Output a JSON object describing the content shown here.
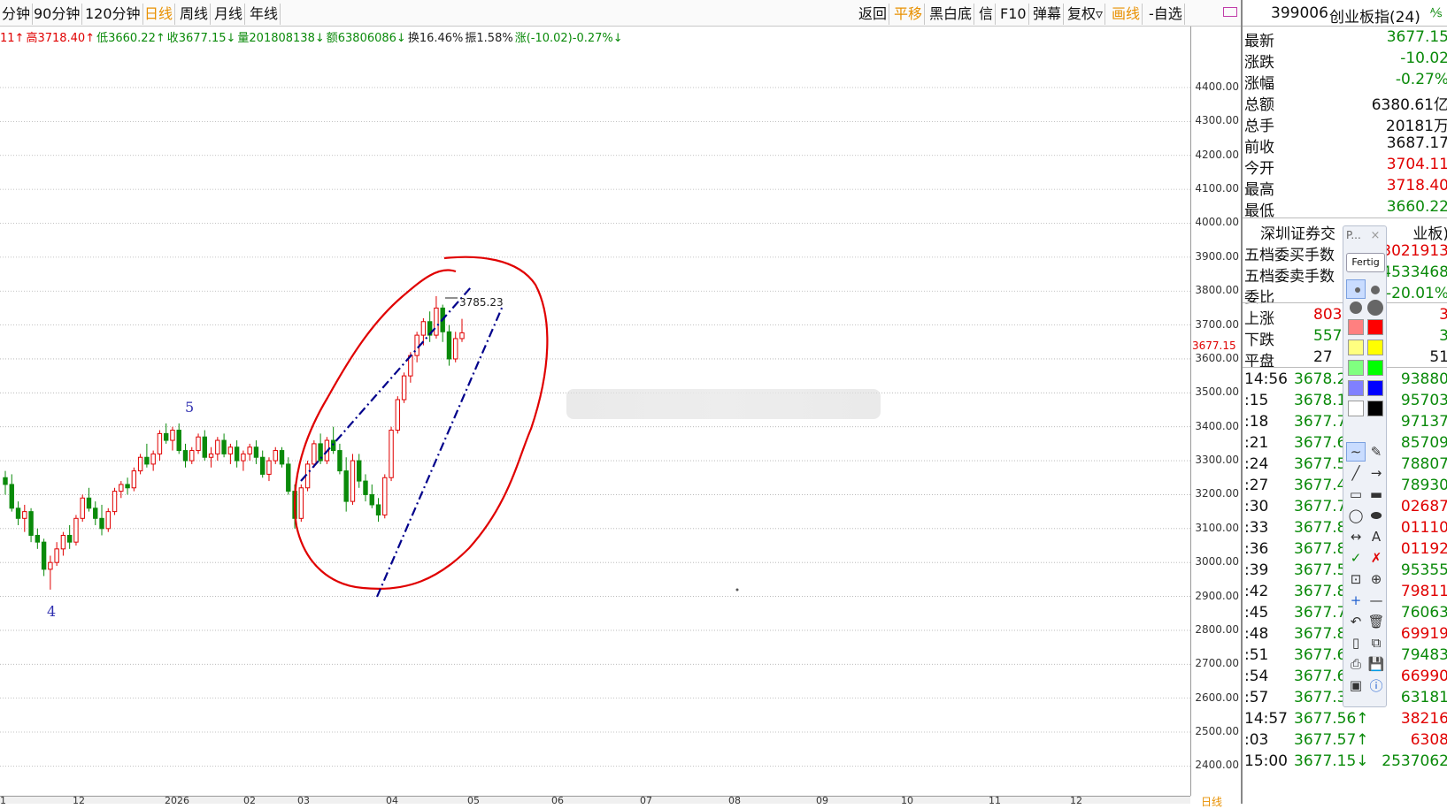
{
  "toolbar": {
    "left_tabs": [
      {
        "label": "分钟",
        "active": false
      },
      {
        "label": "90分钟",
        "active": false
      },
      {
        "label": "120分钟",
        "active": false
      },
      {
        "label": "日线",
        "active": true
      },
      {
        "label": "周线",
        "active": false
      },
      {
        "label": "月线",
        "active": false
      },
      {
        "label": "年线",
        "active": false
      }
    ],
    "right_buttons": [
      {
        "label": "返回",
        "highlight": false
      },
      {
        "label": "平移",
        "highlight": true
      },
      {
        "label": "黑白底",
        "highlight": false
      },
      {
        "label": "信",
        "highlight": false
      },
      {
        "label": "F10",
        "highlight": false
      },
      {
        "label": "弹幕",
        "highlight": false
      },
      {
        "label": "复权▿",
        "highlight": false
      },
      {
        "label": "画线",
        "highlight": true
      },
      {
        "label": "-自选",
        "highlight": false
      }
    ]
  },
  "infoline": [
    {
      "text": "11↑",
      "color": "red"
    },
    {
      "text": "高3718.40↑",
      "color": "red"
    },
    {
      "text": "低3660.22↑",
      "color": "green"
    },
    {
      "text": "收3677.15↓",
      "color": "green"
    },
    {
      "text": "量201808138↓",
      "color": "green"
    },
    {
      "text": "额63806086↓",
      "color": "green"
    },
    {
      "text": "换16.46%",
      "color": "black"
    },
    {
      "text": "振1.58%",
      "color": "black"
    },
    {
      "text": "涨(-10.02)-0.27%↓",
      "color": "green"
    }
  ],
  "price_axis": {
    "ticks": [
      "4400.00",
      "4300.00",
      "4200.00",
      "4100.00",
      "4000.00",
      "3900.00",
      "3800.00",
      "3700.00",
      "3600.00",
      "3500.00",
      "3400.00",
      "3300.00",
      "3200.00",
      "3100.00",
      "3000.00",
      "2900.00",
      "2800.00",
      "2700.00",
      "2600.00",
      "2500.00",
      "2400.00"
    ],
    "last_price": "3677.15"
  },
  "date_axis": {
    "ticks": [
      "1",
      "12",
      "2026",
      "02",
      "03",
      "04",
      "05",
      "06",
      "07",
      "08",
      "09",
      "10",
      "11",
      "12"
    ],
    "bottom_label": "日线"
  },
  "chart_data": {
    "type": "candlestick",
    "wave_labels": [
      "4",
      "5"
    ],
    "high_marker_label": "3785.23",
    "ylim": [
      2400,
      4450
    ],
    "candles": [
      [
        3250,
        3270,
        3200,
        3230
      ],
      [
        3230,
        3260,
        3150,
        3160
      ],
      [
        3160,
        3180,
        3110,
        3130
      ],
      [
        3130,
        3170,
        3090,
        3150
      ],
      [
        3150,
        3160,
        3060,
        3080
      ],
      [
        3080,
        3100,
        3040,
        3060
      ],
      [
        3060,
        3070,
        2960,
        2980
      ],
      [
        2980,
        3020,
        2920,
        3000
      ],
      [
        3000,
        3060,
        2990,
        3040
      ],
      [
        3040,
        3090,
        3020,
        3080
      ],
      [
        3080,
        3110,
        3040,
        3060
      ],
      [
        3060,
        3140,
        3050,
        3130
      ],
      [
        3130,
        3200,
        3120,
        3190
      ],
      [
        3190,
        3220,
        3150,
        3160
      ],
      [
        3160,
        3180,
        3110,
        3130
      ],
      [
        3130,
        3170,
        3080,
        3100
      ],
      [
        3100,
        3160,
        3090,
        3150
      ],
      [
        3150,
        3220,
        3140,
        3210
      ],
      [
        3210,
        3240,
        3190,
        3230
      ],
      [
        3230,
        3250,
        3200,
        3220
      ],
      [
        3220,
        3280,
        3210,
        3270
      ],
      [
        3270,
        3320,
        3260,
        3310
      ],
      [
        3310,
        3350,
        3280,
        3290
      ],
      [
        3290,
        3330,
        3270,
        3320
      ],
      [
        3320,
        3390,
        3300,
        3380
      ],
      [
        3380,
        3410,
        3350,
        3360
      ],
      [
        3360,
        3400,
        3330,
        3390
      ],
      [
        3390,
        3410,
        3320,
        3330
      ],
      [
        3330,
        3350,
        3280,
        3300
      ],
      [
        3300,
        3340,
        3290,
        3330
      ],
      [
        3330,
        3380,
        3320,
        3370
      ],
      [
        3370,
        3390,
        3300,
        3310
      ],
      [
        3310,
        3340,
        3280,
        3320
      ],
      [
        3320,
        3370,
        3300,
        3360
      ],
      [
        3360,
        3380,
        3310,
        3320
      ],
      [
        3320,
        3350,
        3290,
        3340
      ],
      [
        3340,
        3360,
        3280,
        3300
      ],
      [
        3300,
        3330,
        3270,
        3320
      ],
      [
        3320,
        3350,
        3300,
        3340
      ],
      [
        3340,
        3360,
        3290,
        3310
      ],
      [
        3310,
        3330,
        3250,
        3260
      ],
      [
        3260,
        3310,
        3240,
        3300
      ],
      [
        3300,
        3340,
        3290,
        3330
      ],
      [
        3330,
        3340,
        3280,
        3290
      ],
      [
        3290,
        3310,
        3200,
        3210
      ],
      [
        3210,
        3230,
        3100,
        3130
      ],
      [
        3130,
        3230,
        3120,
        3220
      ],
      [
        3220,
        3300,
        3210,
        3290
      ],
      [
        3290,
        3360,
        3280,
        3350
      ],
      [
        3350,
        3380,
        3290,
        3300
      ],
      [
        3300,
        3370,
        3290,
        3360
      ],
      [
        3360,
        3400,
        3320,
        3330
      ],
      [
        3330,
        3350,
        3260,
        3270
      ],
      [
        3270,
        3310,
        3150,
        3180
      ],
      [
        3180,
        3320,
        3170,
        3300
      ],
      [
        3300,
        3320,
        3220,
        3240
      ],
      [
        3240,
        3260,
        3180,
        3200
      ],
      [
        3200,
        3230,
        3160,
        3170
      ],
      [
        3170,
        3190,
        3120,
        3140
      ],
      [
        3140,
        3260,
        3130,
        3250
      ],
      [
        3250,
        3400,
        3240,
        3390
      ],
      [
        3390,
        3490,
        3380,
        3480
      ],
      [
        3480,
        3560,
        3470,
        3550
      ],
      [
        3550,
        3620,
        3530,
        3610
      ],
      [
        3610,
        3680,
        3590,
        3670
      ],
      [
        3670,
        3720,
        3640,
        3710
      ],
      [
        3710,
        3740,
        3650,
        3670
      ],
      [
        3670,
        3785,
        3660,
        3750
      ],
      [
        3750,
        3760,
        3650,
        3680
      ],
      [
        3680,
        3700,
        3580,
        3600
      ],
      [
        3600,
        3680,
        3590,
        3660
      ],
      [
        3660,
        3718,
        3650,
        3677
      ]
    ]
  },
  "right_panel": {
    "code": "399006",
    "name": "创业板指(24)",
    "mark": "⅍",
    "quote_rows": [
      {
        "label": "最新",
        "value": "3677.15",
        "color": "green"
      },
      {
        "label": "涨跌",
        "value": "-10.02",
        "color": "green"
      },
      {
        "label": "涨幅",
        "value": "-0.27%",
        "color": "green"
      },
      {
        "label": "总额",
        "value": "6380.61亿",
        "color": "black"
      },
      {
        "label": "总手",
        "value": "20181万",
        "color": "black"
      },
      {
        "label": "前收",
        "value": "3687.17",
        "color": "black"
      },
      {
        "label": "今开",
        "value": "3704.11",
        "color": "red"
      },
      {
        "label": "最高",
        "value": "3718.40",
        "color": "red"
      },
      {
        "label": "最低",
        "value": "3660.22",
        "color": "green"
      }
    ],
    "exchange": "深圳证券交",
    "exchange_tail": "业板)",
    "order_rows": [
      {
        "label": "五档委买手数",
        "value": "3021913",
        "color": "red"
      },
      {
        "label": "五档委卖手数",
        "value": "4533468",
        "color": "green"
      },
      {
        "label": "委比",
        "value": "-20.01%",
        "color": "green"
      }
    ],
    "breadth_rows": [
      {
        "label": "上涨",
        "value": "803",
        "color": "red",
        "tail": "3"
      },
      {
        "label": "下跌",
        "value": "557",
        "color": "green",
        "tail": "3"
      },
      {
        "label": "平盘",
        "value": "27",
        "color": "black",
        "tail": "51"
      }
    ],
    "ticks": [
      {
        "time": "14:56",
        "price": "3678.2",
        "vol": "93880",
        "vcolor": "green"
      },
      {
        "time": ":15",
        "price": "3678.1",
        "vol": "95703",
        "vcolor": "green"
      },
      {
        "time": ":18",
        "price": "3677.7",
        "vol": "97137",
        "vcolor": "green"
      },
      {
        "time": ":21",
        "price": "3677.6",
        "vol": "85709",
        "vcolor": "green"
      },
      {
        "time": ":24",
        "price": "3677.5",
        "vol": "78807",
        "vcolor": "green"
      },
      {
        "time": ":27",
        "price": "3677.4",
        "vol": "78930",
        "vcolor": "green"
      },
      {
        "time": ":30",
        "price": "3677.7",
        "vol": "02687",
        "vcolor": "red"
      },
      {
        "time": ":33",
        "price": "3677.8",
        "vol": "01110",
        "vcolor": "red"
      },
      {
        "time": ":36",
        "price": "3677.8",
        "vol": "01192",
        "vcolor": "red"
      },
      {
        "time": ":39",
        "price": "3677.5",
        "vol": "95355",
        "vcolor": "green"
      },
      {
        "time": ":42",
        "price": "3677.8",
        "vol": "79811",
        "vcolor": "red"
      },
      {
        "time": ":45",
        "price": "3677.7",
        "vol": "76063",
        "vcolor": "green"
      },
      {
        "time": ":48",
        "price": "3677.8",
        "vol": "69919",
        "vcolor": "red"
      },
      {
        "time": ":51",
        "price": "3677.6",
        "vol": "79483",
        "vcolor": "green"
      },
      {
        "time": ":54",
        "price": "3677.6",
        "vol": "66990",
        "vcolor": "red"
      },
      {
        "time": ":57",
        "price": "3677.36↓",
        "vol": "63181",
        "vcolor": "green"
      },
      {
        "time": "14:57",
        "price": "3677.56↑",
        "vol": "38216",
        "vcolor": "red"
      },
      {
        "time": ":03",
        "price": "3677.57↑",
        "vol": "6308",
        "vcolor": "red"
      },
      {
        "time": "15:00",
        "price": "3677.15↓",
        "vol": "2537062",
        "vcolor": "green"
      }
    ]
  },
  "palette": {
    "title": "P...",
    "close": "×",
    "done_label": "Fertig",
    "colors": [
      "#ff8080",
      "#ff0000",
      "#ffff80",
      "#ffff00",
      "#80ff80",
      "#00ff00",
      "#8080ff",
      "#0000ff",
      "#ffffff",
      "#000000"
    ],
    "tools": [
      "∼",
      "✎",
      "╱",
      "→",
      "▭",
      "▬",
      "◯",
      "⬬",
      "↔",
      "A",
      "✓",
      "✗",
      "⊡",
      "⊕",
      "+",
      "—",
      "↶",
      "🗑",
      "▯",
      "⧉",
      "⎙",
      "💾",
      "▣",
      "ⓘ"
    ],
    "text_tool_label": "A"
  },
  "colors": {
    "up": "#e00000",
    "down": "#0a8a0a",
    "annotation_red": "#e00000",
    "trendline": "#00008b",
    "grid": "#b0b0b0",
    "accent": "#e89000"
  }
}
